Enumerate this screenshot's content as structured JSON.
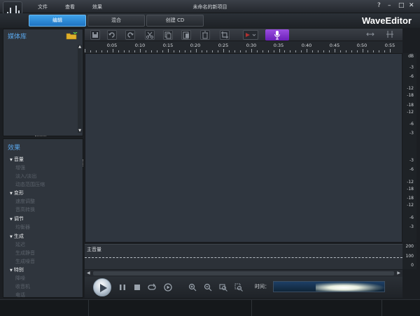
{
  "window": {
    "title": "未命名的新项目",
    "menu": [
      "文件",
      "查看",
      "效果"
    ],
    "controls": {
      "help": "?",
      "minimize": "–",
      "maximize": "□",
      "close": "✕"
    },
    "brand": "WaveEditor"
  },
  "mode_tabs": [
    {
      "label": "编辑",
      "active": true
    },
    {
      "label": "混合",
      "active": false
    },
    {
      "label": "创建 CD",
      "active": false
    }
  ],
  "media_library": {
    "title": "媒体库",
    "icon": "folder-add-icon"
  },
  "effects": {
    "title": "效果",
    "categories": [
      {
        "label": "音量",
        "items": [
          "增强",
          "淡入/淡出",
          "动态范围压缩"
        ]
      },
      {
        "label": "变形",
        "items": [
          "速度调整",
          "音高转换"
        ]
      },
      {
        "label": "调节",
        "items": [
          "均衡器"
        ]
      },
      {
        "label": "生成",
        "items": [
          "延迟",
          "生成静音",
          "生成噪音"
        ]
      },
      {
        "label": "特别",
        "items": [
          "降噪",
          "收音机",
          "电话"
        ]
      }
    ]
  },
  "toolbar": {
    "icons": [
      "save-icon",
      "undo-icon",
      "redo-icon",
      "cut-icon",
      "copy-icon",
      "paste-icon",
      "delete-icon",
      "crop-icon",
      "record-icon",
      "mic-icon",
      "split-icon",
      "fit-icon"
    ]
  },
  "ruler": {
    "labels": [
      "0:05",
      "0:10",
      "0:15",
      "0:20",
      "0:25",
      "0:30",
      "0:35",
      "0:40",
      "0:45",
      "0:50",
      "0:55"
    ]
  },
  "db_scale": {
    "unit": "dB",
    "labels_top": [
      "-3",
      "-6",
      "-12",
      "-18",
      "-18",
      "-12",
      "-6",
      "-3"
    ],
    "labels_bottom": [
      "-3",
      "-6",
      "-12",
      "-18",
      "-18",
      "-12",
      "-6",
      "-3"
    ]
  },
  "volume_track": {
    "label": "主音量",
    "scale": [
      "200",
      "100",
      "0"
    ]
  },
  "transport": {
    "time_label": "时间：",
    "icons": [
      "play-icon",
      "pause-icon",
      "stop-icon",
      "loop-icon",
      "skip-icon",
      "zoom-in-icon",
      "zoom-out-icon",
      "zoom-fit-icon",
      "zoom-selection-icon"
    ]
  },
  "colors": {
    "accent": "#2a8ad8",
    "mic_button": "#8a3ed6",
    "effects_title": "#5aa7ec"
  }
}
